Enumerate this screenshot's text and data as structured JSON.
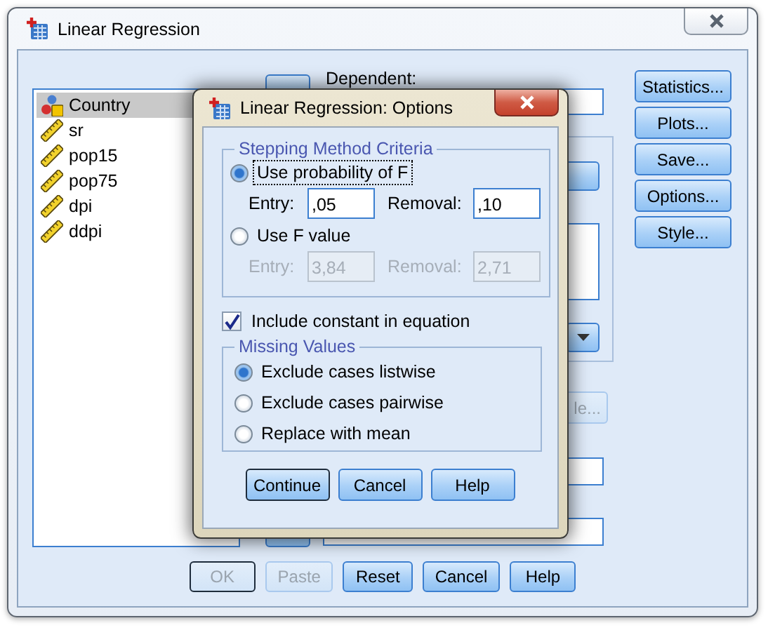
{
  "window": {
    "title": "Linear Regression"
  },
  "variables": [
    {
      "name": "Country",
      "kind": "nominal",
      "selected": true
    },
    {
      "name": "sr",
      "kind": "scale",
      "selected": false
    },
    {
      "name": "pop15",
      "kind": "scale",
      "selected": false
    },
    {
      "name": "pop75",
      "kind": "scale",
      "selected": false
    },
    {
      "name": "dpi",
      "kind": "scale",
      "selected": false
    },
    {
      "name": "ddpi",
      "kind": "scale",
      "selected": false
    }
  ],
  "dependent": {
    "label": "Dependent:"
  },
  "partial_button": {
    "label": "le...",
    "disabled": true
  },
  "side_buttons": [
    {
      "label": "Statistics..."
    },
    {
      "label": "Plots..."
    },
    {
      "label": "Save..."
    },
    {
      "label": "Options..."
    },
    {
      "label": "Style..."
    }
  ],
  "bottom_buttons": [
    {
      "label": "OK",
      "disabled": true,
      "default": true
    },
    {
      "label": "Paste",
      "disabled": true,
      "default": false
    },
    {
      "label": "Reset",
      "disabled": false,
      "default": false
    },
    {
      "label": "Cancel",
      "disabled": false,
      "default": false
    },
    {
      "label": "Help",
      "disabled": false,
      "default": false
    }
  ],
  "options_dialog": {
    "title": "Linear Regression: Options",
    "stepping": {
      "title": "Stepping Method Criteria",
      "methods": [
        {
          "label": "Use probability of F",
          "selected": true,
          "focused": true,
          "disabled": false,
          "entry_label": "Entry:",
          "entry_value": ",05",
          "removal_label": "Removal:",
          "removal_value": ",10"
        },
        {
          "label": "Use F value",
          "selected": false,
          "focused": false,
          "disabled": true,
          "entry_label": "Entry:",
          "entry_value": "3,84",
          "removal_label": "Removal:",
          "removal_value": "2,71"
        }
      ]
    },
    "include_constant": {
      "label": "Include constant in equation",
      "checked": true
    },
    "missing": {
      "title": "Missing Values",
      "options": [
        {
          "label": "Exclude cases listwise",
          "selected": true
        },
        {
          "label": "Exclude cases pairwise",
          "selected": false
        },
        {
          "label": "Replace with mean",
          "selected": false
        }
      ]
    },
    "buttons": [
      {
        "label": "Continue",
        "default": true
      },
      {
        "label": "Cancel",
        "default": false
      },
      {
        "label": "Help",
        "default": false
      }
    ]
  }
}
